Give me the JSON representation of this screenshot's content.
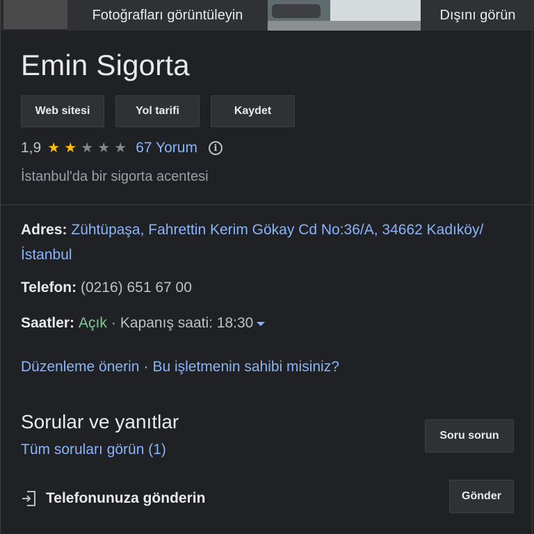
{
  "photos": {
    "view_photos_label": "Fotoğrafları görüntüleyin",
    "view_outside_label": "Dışını görün"
  },
  "business": {
    "name": "Emin Sigorta",
    "category": "İstanbul'da bir sigorta acentesi"
  },
  "actions": {
    "website": "Web sitesi",
    "directions": "Yol tarifi",
    "save": "Kaydet"
  },
  "rating": {
    "value": "1,9",
    "stars_filled": 2,
    "stars_total": 5,
    "reviews_label": "67 Yorum"
  },
  "details": {
    "address_label": "Adres:",
    "address_value": "Zühtüpaşa, Fahrettin Kerim Gökay Cd No:36/A, 34662 Kadıköy/İstanbul",
    "phone_label": "Telefon:",
    "phone_value": "(0216) 651 67 00",
    "hours_label": "Saatler:",
    "hours_status": "Açık",
    "hours_separator": "·",
    "hours_close": "Kapanış saati: 18:30"
  },
  "links": {
    "suggest_edit": "Düzenleme önerin",
    "separator": "·",
    "own_business": "Bu işletmenin sahibi misiniz?"
  },
  "qa": {
    "title": "Sorular ve yanıtlar",
    "see_all": "Tüm soruları görün (1)",
    "ask_button": "Soru sorun"
  },
  "send": {
    "label": "Telefonunuza gönderin",
    "button": "Gönder"
  },
  "colors": {
    "background": "#202124",
    "link": "#8ab4f8",
    "star": "#fbbc04",
    "open": "#81c995"
  }
}
